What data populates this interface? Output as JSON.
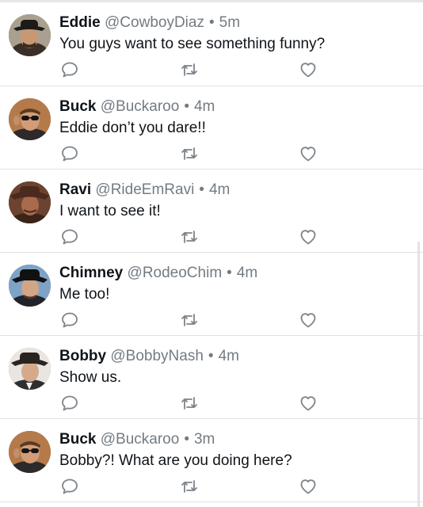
{
  "tweets": [
    {
      "name": "Eddie",
      "handle": "@CowboyDiaz",
      "time": "5m",
      "text": "You guys want to see something funny?",
      "avatar": "eddie-avatar"
    },
    {
      "name": "Buck",
      "handle": "@Buckaroo",
      "time": "4m",
      "text": "Eddie don’t you dare!!",
      "avatar": "buck-avatar"
    },
    {
      "name": "Ravi",
      "handle": "@RideEmRavi",
      "time": "4m",
      "text": "I want to see it!",
      "avatar": "ravi-avatar"
    },
    {
      "name": "Chimney",
      "handle": "@RodeoChim",
      "time": "4m",
      "text": "Me too!",
      "avatar": "chimney-avatar"
    },
    {
      "name": "Bobby",
      "handle": "@BobbyNash",
      "time": "4m",
      "text": "Show us.",
      "avatar": "bobby-avatar"
    },
    {
      "name": "Buck",
      "handle": "@Buckaroo",
      "time": "3m",
      "text": "Bobby?! What are you doing here?",
      "avatar": "buck-avatar"
    }
  ],
  "separator": "•",
  "icons": {
    "reply": "reply-icon",
    "retweet": "retweet-icon",
    "like": "heart-icon"
  },
  "colors": {
    "text": "#0f1419",
    "secondary": "#737b82",
    "icon": "#7d848a",
    "divider": "#e1e1e1"
  }
}
